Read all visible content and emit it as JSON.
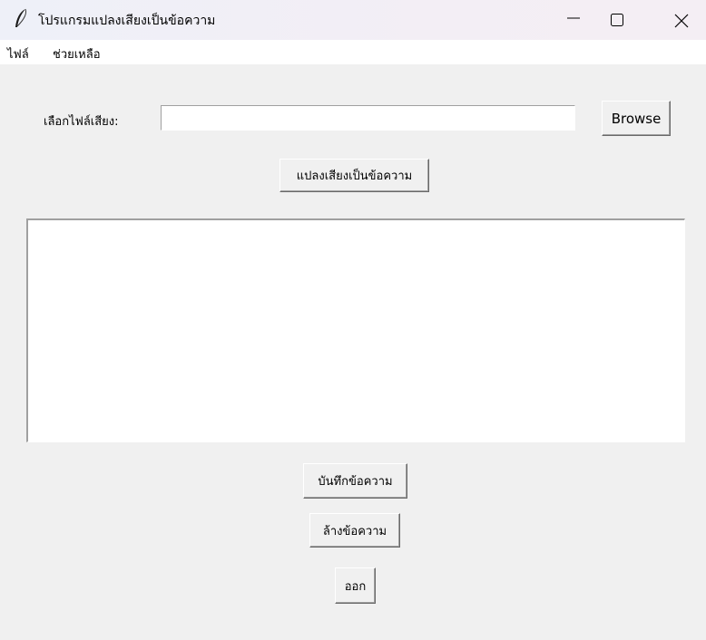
{
  "window": {
    "title": "โปรแกรมแปลงเสียงเป็นข้อความ",
    "icon": "feather-icon",
    "controls": [
      "minimize-icon",
      "maximize-icon",
      "close-icon"
    ]
  },
  "menu": {
    "items": [
      {
        "label": "ไฟล์"
      },
      {
        "label": "ช่วยเหลือ"
      }
    ]
  },
  "file_select": {
    "label": "เลือกไฟล์เสียง:",
    "value": "",
    "browse_label": "Browse"
  },
  "convert_button": "แปลงเสียงเป็นข้อความ",
  "output": {
    "value": ""
  },
  "save_button": "บันทึกข้อความ",
  "clear_button": "ล้างข้อความ",
  "exit_button": "ออก"
}
